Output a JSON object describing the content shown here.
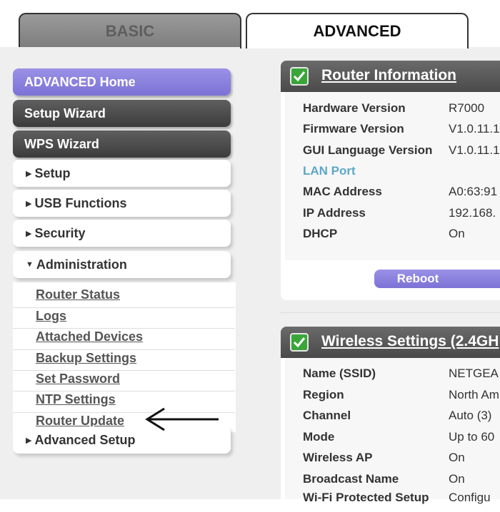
{
  "tabs": {
    "basic": "BASIC",
    "advanced": "ADVANCED"
  },
  "menu": {
    "advanced_home": "ADVANCED Home",
    "setup_wizard": "Setup Wizard",
    "wps_wizard": "WPS Wizard",
    "setup": "Setup",
    "usb_functions": "USB Functions",
    "security": "Security",
    "administration": "Administration",
    "admin_items": [
      "Router Status",
      "Logs",
      "Attached Devices",
      "Backup Settings",
      "Set Password",
      "NTP Settings",
      "Router Update"
    ],
    "advanced_setup": "Advanced Setup"
  },
  "router_info": {
    "title": "Router Information",
    "rows": [
      {
        "label": "Hardware Version",
        "value": "R7000"
      },
      {
        "label": "Firmware Version",
        "value": "V1.0.11.1"
      },
      {
        "label": "GUI Language Version",
        "value": "V1.0.11.1"
      },
      {
        "label": "LAN Port",
        "value": ""
      },
      {
        "label": "MAC Address",
        "value": "A0:63:91"
      },
      {
        "label": "IP Address",
        "value": "192.168."
      },
      {
        "label": "DHCP",
        "value": "On"
      }
    ],
    "reboot": "Reboot"
  },
  "wireless": {
    "title": "Wireless Settings (2.4GH",
    "rows": [
      {
        "label": "Name (SSID)",
        "value": "NETGEA"
      },
      {
        "label": "Region",
        "value": "North Am"
      },
      {
        "label": "Channel",
        "value": "Auto (3)"
      },
      {
        "label": "Mode",
        "value": "Up to 60"
      },
      {
        "label": "Wireless AP",
        "value": "On"
      },
      {
        "label": "Broadcast Name",
        "value": "On"
      },
      {
        "label": "Wi-Fi Protected Setup",
        "value": "Configu"
      }
    ]
  },
  "colors": {
    "accent_purple": "#8a80e0",
    "check_green": "#3aa63a",
    "dark_header": "#555555"
  }
}
